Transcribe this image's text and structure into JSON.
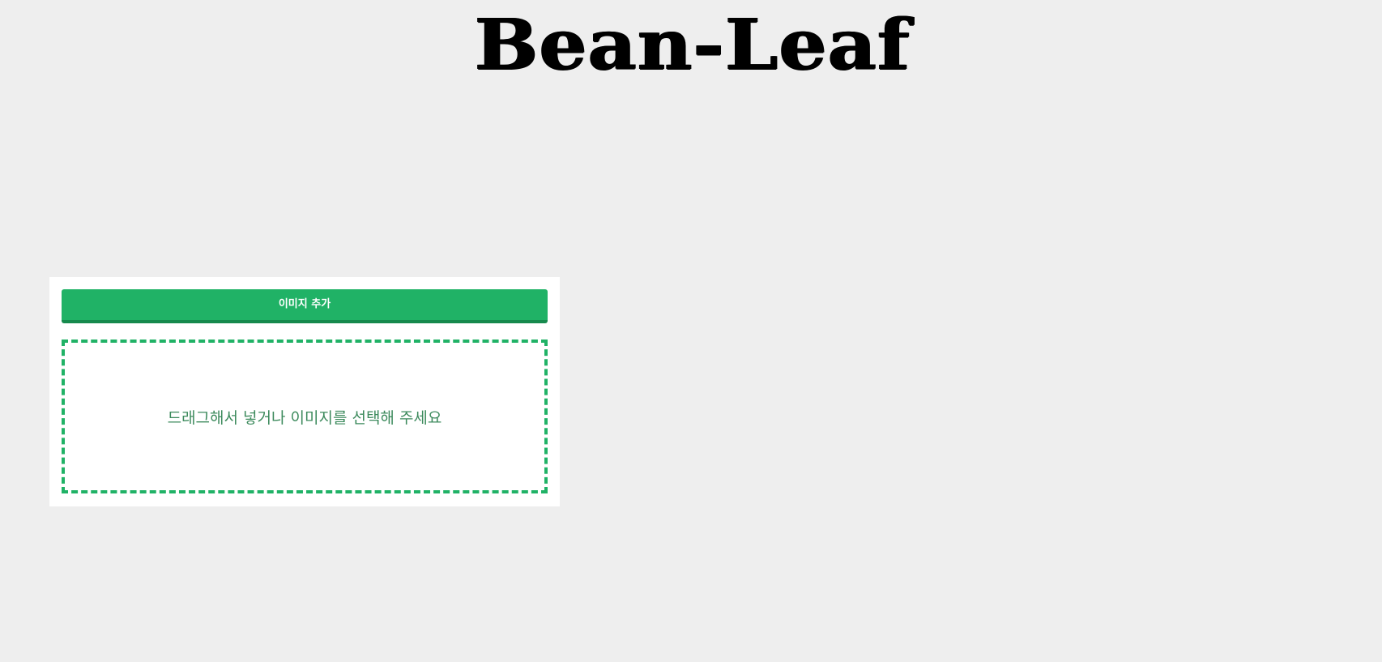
{
  "header": {
    "logo_text": "Bean-Leaf"
  },
  "uploader": {
    "add_image_label": "이미지 추가",
    "dropzone_text": "드래그해서 넣거나 이미지를 선택해 주세요"
  },
  "colors": {
    "background": "#eeeeee",
    "panel": "#ffffff",
    "accent": "#20b266",
    "accent_dark": "#168a4d",
    "dropzone_text": "#3c8a5c"
  }
}
